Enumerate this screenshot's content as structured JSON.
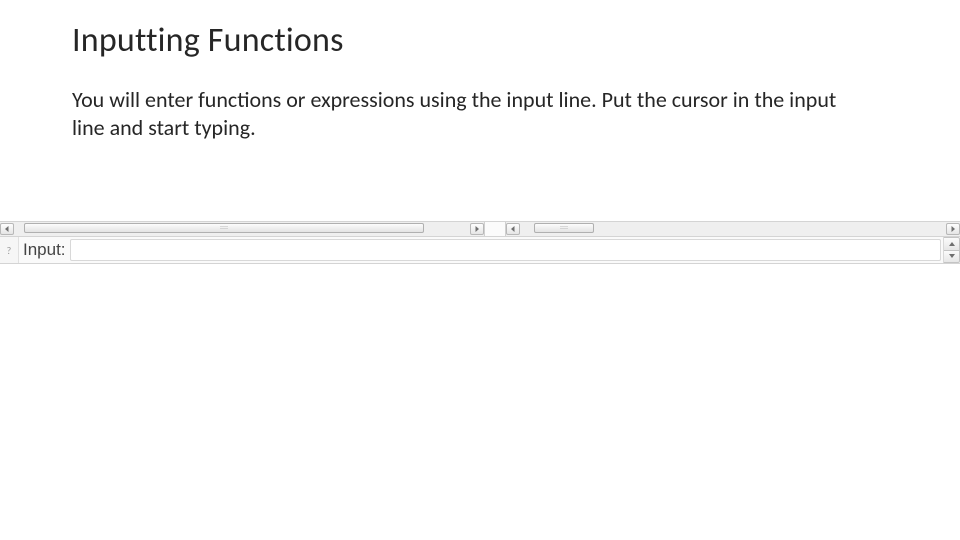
{
  "title": "Inputting Functions",
  "body": "You will enter functions or expressions using the input line. Put the cursor in the input line and start typing.",
  "input": {
    "label": "Input:",
    "value": "",
    "placeholder": ""
  },
  "icons": {
    "help": "?"
  }
}
